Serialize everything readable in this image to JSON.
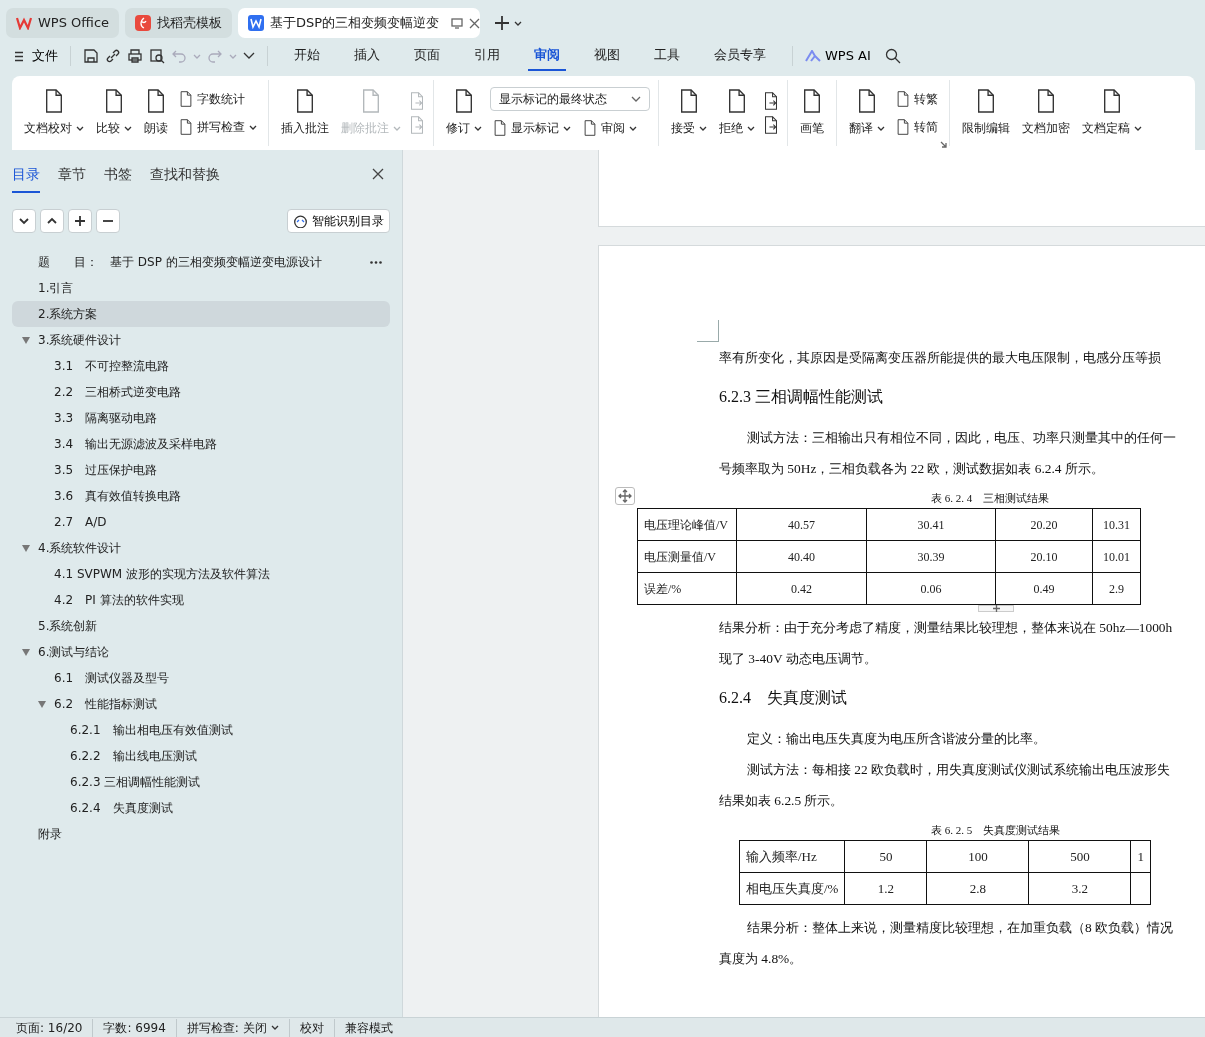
{
  "tabs": [
    {
      "kind": "home",
      "label": "WPS Office",
      "selected": false
    },
    {
      "kind": "template",
      "label": "找稻壳模板",
      "selected": false
    },
    {
      "kind": "document",
      "label": "基于DSP的三相变频变幅逆变",
      "selected": true
    }
  ],
  "menu": {
    "file": "文件",
    "tabs": [
      {
        "label": "开始",
        "selected": false
      },
      {
        "label": "插入",
        "selected": false
      },
      {
        "label": "页面",
        "selected": false
      },
      {
        "label": "引用",
        "selected": false
      },
      {
        "label": "审阅",
        "selected": true
      },
      {
        "label": "视图",
        "selected": false
      },
      {
        "label": "工具",
        "selected": false
      },
      {
        "label": "会员专享",
        "selected": false
      }
    ],
    "ai": "WPS AI"
  },
  "ribbon": {
    "groups": [
      {
        "items": [
          {
            "kind": "large",
            "label": "文档校对",
            "dropdown": true,
            "disabled": false
          },
          {
            "kind": "large",
            "label": "比较",
            "dropdown": true,
            "disabled": false
          },
          {
            "kind": "large",
            "label": "朗读",
            "dropdown": false,
            "disabled": false
          },
          {
            "kind": "stack",
            "rows": [
              [
                {
                  "kind": "small",
                  "label": "字数统计",
                  "dropdown": false,
                  "disabled": false
                }
              ],
              [
                {
                  "kind": "small",
                  "label": "拼写检查",
                  "dropdown": true,
                  "disabled": false
                }
              ]
            ]
          }
        ]
      },
      {
        "items": [
          {
            "kind": "large",
            "label": "插入批注",
            "dropdown": false,
            "disabled": false
          },
          {
            "kind": "large",
            "label": "删除批注",
            "dropdown": true,
            "disabled": true
          },
          {
            "kind": "stack",
            "rows": [
              [
                {
                  "kind": "icon",
                  "disabled": true
                }
              ],
              [
                {
                  "kind": "icon",
                  "disabled": true
                }
              ]
            ]
          }
        ]
      },
      {
        "items": [
          {
            "kind": "large",
            "label": "修订",
            "dropdown": true,
            "disabled": false
          },
          {
            "kind": "stack",
            "rows": [
              [
                {
                  "kind": "select",
                  "label": "显示标记的最终状态",
                  "disabled": false
                }
              ],
              [
                {
                  "kind": "small",
                  "label": "显示标记",
                  "dropdown": true,
                  "disabled": false
                },
                {
                  "kind": "small",
                  "label": "审阅",
                  "dropdown": true,
                  "disabled": false
                }
              ]
            ]
          }
        ]
      },
      {
        "items": [
          {
            "kind": "large",
            "label": "接受",
            "dropdown": true,
            "disabled": false
          },
          {
            "kind": "large",
            "label": "拒绝",
            "dropdown": true,
            "disabled": false
          },
          {
            "kind": "stack",
            "rows": [
              [
                {
                  "kind": "icon",
                  "disabled": false
                }
              ],
              [
                {
                  "kind": "icon",
                  "disabled": false
                }
              ]
            ]
          }
        ]
      },
      {
        "items": [
          {
            "kind": "large",
            "label": "画笔",
            "dropdown": false,
            "disabled": false
          }
        ]
      },
      {
        "launcher": true,
        "items": [
          {
            "kind": "large",
            "label": "翻译",
            "dropdown": true,
            "disabled": false
          },
          {
            "kind": "stack",
            "rows": [
              [
                {
                  "kind": "small",
                  "label": "转繁",
                  "dropdown": false,
                  "disabled": false
                }
              ],
              [
                {
                  "kind": "small",
                  "label": "转简",
                  "dropdown": false,
                  "disabled": false
                }
              ]
            ]
          }
        ]
      },
      {
        "items": [
          {
            "kind": "large",
            "label": "限制编辑",
            "dropdown": false,
            "disabled": false
          },
          {
            "kind": "large",
            "label": "文档加密",
            "dropdown": false,
            "disabled": false
          },
          {
            "kind": "large",
            "label": "文档定稿",
            "dropdown": true,
            "disabled": false
          }
        ]
      }
    ]
  },
  "sidebar": {
    "tabs": [
      {
        "label": "目录",
        "selected": true
      },
      {
        "label": "章节",
        "selected": false
      },
      {
        "label": "书签",
        "selected": false
      },
      {
        "label": "查找和替换",
        "selected": false
      }
    ],
    "smart_button": "智能识别目录",
    "toc": [
      {
        "text": "题　　目：　基于 DSP 的三相变频变幅逆变电源设计",
        "selected": false,
        "hovered": true
      },
      {
        "text": "1.引言",
        "selected": false,
        "hovered": false
      },
      {
        "text": "2.系统方案",
        "selected": true,
        "hovered": false
      },
      {
        "text": "3.系统硬件设计",
        "selected": false,
        "hovered": false,
        "expanded": true,
        "children": [
          {
            "text": "3.1　不可控整流电路",
            "selected": false,
            "hovered": false
          },
          {
            "text": "2.2　三相桥式逆变电路",
            "selected": false,
            "hovered": false
          },
          {
            "text": "3.3　隔离驱动电路",
            "selected": false,
            "hovered": false
          },
          {
            "text": "3.4　输出无源滤波及采样电路",
            "selected": false,
            "hovered": false
          },
          {
            "text": "3.5　过压保护电路",
            "selected": false,
            "hovered": false
          },
          {
            "text": "3.6　真有效值转换电路",
            "selected": false,
            "hovered": false
          },
          {
            "text": "2.7　A/D",
            "selected": false,
            "hovered": false
          }
        ]
      },
      {
        "text": "4.系统软件设计",
        "selected": false,
        "hovered": false,
        "expanded": true,
        "children": [
          {
            "text": "4.1 SVPWM 波形的实现方法及软件算法",
            "selected": false,
            "hovered": false
          },
          {
            "text": "4.2　PI 算法的软件实现",
            "selected": false,
            "hovered": false
          }
        ]
      },
      {
        "text": "5.系统创新",
        "selected": false,
        "hovered": false
      },
      {
        "text": "6.测试与结论",
        "selected": false,
        "hovered": false,
        "expanded": true,
        "children": [
          {
            "text": "6.1　测试仪器及型号",
            "selected": false,
            "hovered": false
          },
          {
            "text": "6.2　性能指标测试",
            "selected": false,
            "hovered": false,
            "expanded": true,
            "children": [
              {
                "text": "6.2.1　输出相电压有效值测试",
                "selected": false,
                "hovered": false
              },
              {
                "text": "6.2.2　输出线电压测试",
                "selected": false,
                "hovered": false
              },
              {
                "text": "6.2.3 三相调幅性能测试",
                "selected": false,
                "hovered": false
              },
              {
                "text": "6.2.4　失真度测试",
                "selected": false,
                "hovered": false
              }
            ]
          }
        ]
      },
      {
        "text": "附录",
        "selected": false,
        "hovered": false
      }
    ]
  },
  "document": {
    "blocks": [
      {
        "kind": "paragraph",
        "indent": false,
        "text": "率有所变化，其原因是受隔离变压器所能提供的最大电压限制，电感分压等损"
      },
      {
        "kind": "heading",
        "text": "6.2.3 三相调幅性能测试"
      },
      {
        "kind": "paragraph",
        "indent": true,
        "text": "测试方法：三相输出只有相位不同，因此，电压、功率只测量其中的任何一"
      },
      {
        "kind": "paragraph",
        "indent": false,
        "text": "号频率取为 50Hz，三相负载各为 22 欧，测试数据如表 6.2.4 所示。"
      },
      {
        "kind": "caption",
        "text": "表 6. 2. 4　三相测试结果"
      },
      {
        "kind": "table",
        "rows": [
          [
            "电压理论峰值/V",
            "40.57",
            "30.41",
            "20.20",
            "10.31"
          ],
          [
            "电压测量值/V",
            "40.40",
            "30.39",
            "20.10",
            "10.01"
          ],
          [
            "误差/%",
            "0.42",
            "0.06",
            "0.49",
            "2.9"
          ]
        ]
      },
      {
        "kind": "paragraph",
        "indent": false,
        "text": "结果分析：由于充分考虑了精度，测量结果比较理想，整体来说在 50hz—1000h"
      },
      {
        "kind": "paragraph",
        "indent": false,
        "text": "现了 3-40V 动态电压调节。"
      },
      {
        "kind": "heading",
        "text": "6.2.4　失真度测试"
      },
      {
        "kind": "paragraph",
        "indent": true,
        "text": "定义：输出电压失真度为电压所含谐波分量的比率。"
      },
      {
        "kind": "paragraph",
        "indent": true,
        "text": "测试方法：每相接 22 欧负载时，用失真度测试仪测试系统输出电压波形失"
      },
      {
        "kind": "paragraph",
        "indent": false,
        "text": "结果如表 6.2.5 所示。"
      },
      {
        "kind": "caption",
        "text": "表 6. 2. 5　失真度测试结果"
      },
      {
        "kind": "table",
        "rows": [
          [
            "输入频率/Hz",
            "50",
            "100",
            "500",
            "1"
          ],
          [
            "相电压失真度/%",
            "1.2",
            "2.8",
            "3.2",
            ""
          ]
        ]
      },
      {
        "kind": "paragraph",
        "indent": true,
        "text": "结果分析：整体上来说，测量精度比较理想，在加重负载（8 欧负载）情况"
      },
      {
        "kind": "paragraph",
        "indent": false,
        "text": "真度为 4.8%。"
      }
    ]
  },
  "status_bar": [
    {
      "text": "页面: 16/20",
      "dropdown": false
    },
    {
      "text": "字数: 6994",
      "dropdown": false
    },
    {
      "text": "拼写检查: 关闭",
      "dropdown": true
    },
    {
      "text": "校对",
      "dropdown": false
    },
    {
      "text": "兼容模式",
      "dropdown": false
    }
  ]
}
